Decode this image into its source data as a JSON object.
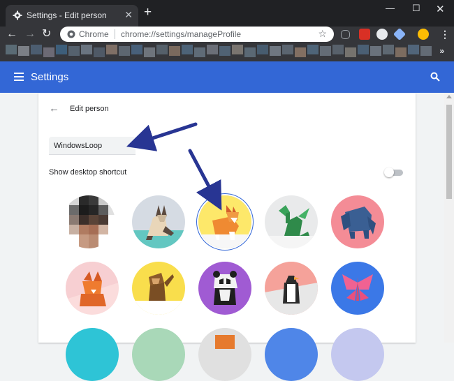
{
  "browser": {
    "tab_title": "Settings - Edit person",
    "tab_icon": "gear-icon",
    "omnibox": {
      "site_label": "Chrome",
      "url": "chrome://settings/manageProfile"
    }
  },
  "app": {
    "title": "Settings",
    "header_color": "#3367d6"
  },
  "edit_person": {
    "title": "Edit person",
    "name_value": "WindowsLoop",
    "shortcut_label": "Show desktop shortcut",
    "shortcut_enabled": false,
    "selected_avatar": "corgi",
    "avatars": [
      {
        "name": "pixelated-photo-avatar"
      },
      {
        "name": "siamese-cat-avatar"
      },
      {
        "name": "corgi-avatar"
      },
      {
        "name": "dragon-avatar"
      },
      {
        "name": "elephant-avatar"
      },
      {
        "name": "fox-avatar"
      },
      {
        "name": "monkey-avatar"
      },
      {
        "name": "panda-avatar"
      },
      {
        "name": "penguin-avatar"
      },
      {
        "name": "butterfly-avatar"
      }
    ]
  },
  "annotation_color": "#283593"
}
